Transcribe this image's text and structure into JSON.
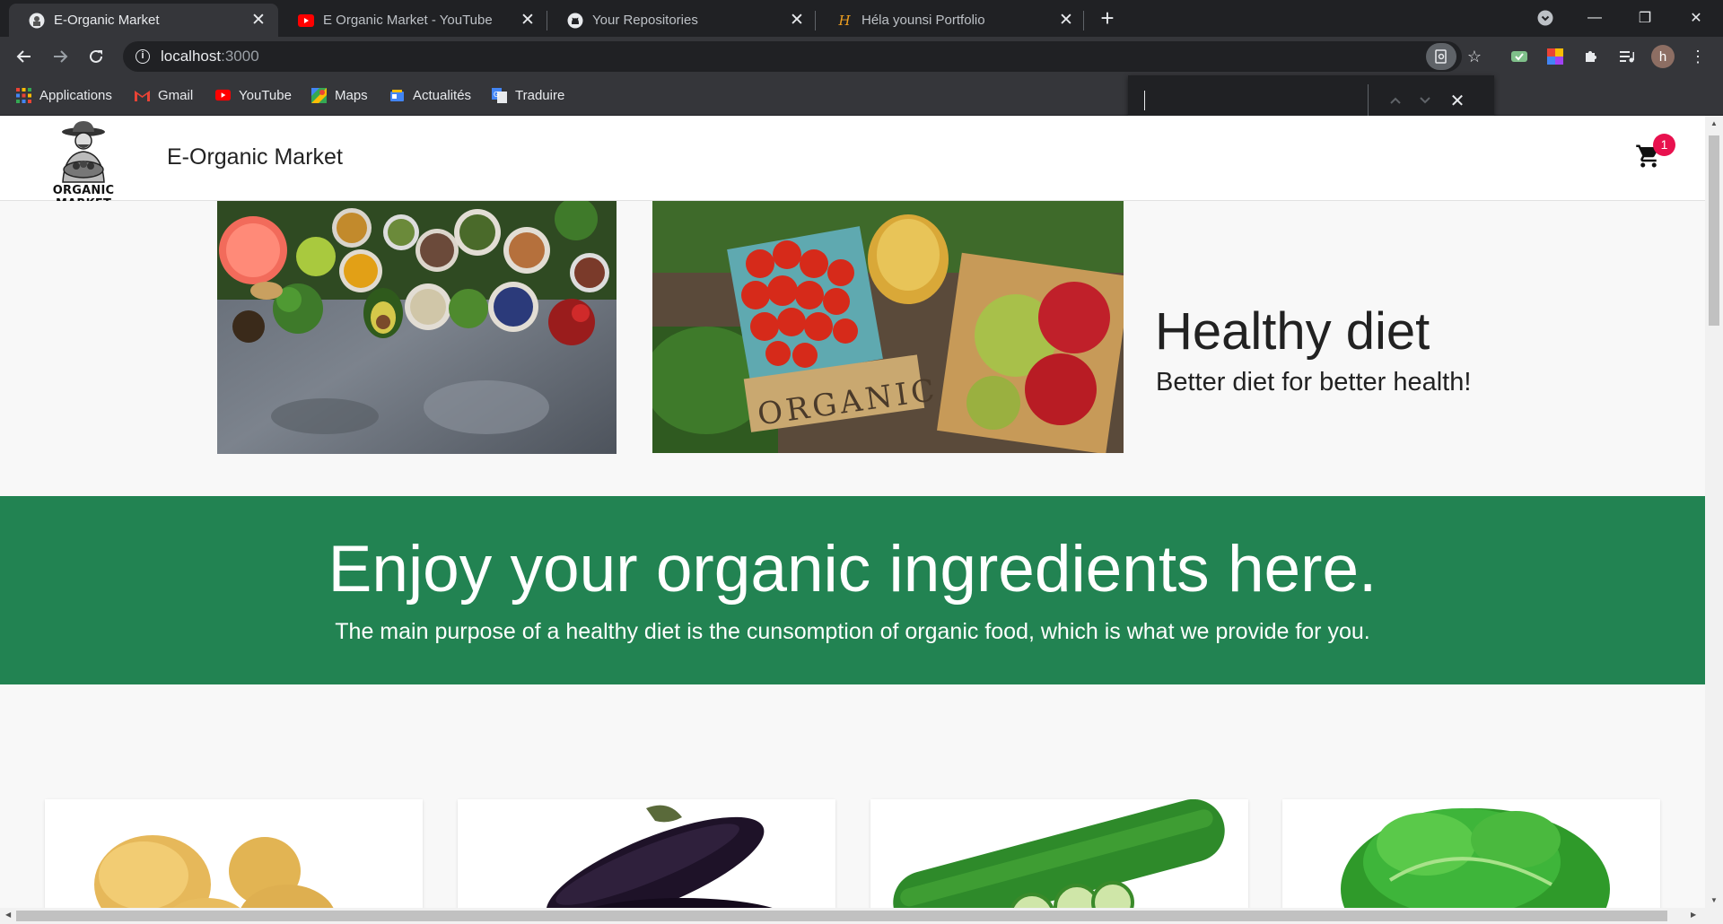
{
  "browser": {
    "tabs": [
      {
        "title": "E-Organic Market",
        "active": true,
        "favicon": "site-favicon"
      },
      {
        "title": "E Organic Market - YouTube",
        "active": false,
        "favicon": "youtube-icon"
      },
      {
        "title": "Your Repositories",
        "active": false,
        "favicon": "github-icon"
      },
      {
        "title": "Héla younsi Portfolio",
        "active": false,
        "favicon": "portfolio-icon"
      }
    ],
    "url_host": "localhost",
    "url_port": ":3000",
    "bookmarks": [
      {
        "label": "Applications",
        "icon": "apps-grid-icon"
      },
      {
        "label": "Gmail",
        "icon": "gmail-icon"
      },
      {
        "label": "YouTube",
        "icon": "youtube-icon"
      },
      {
        "label": "Maps",
        "icon": "maps-icon"
      },
      {
        "label": "Actualités",
        "icon": "news-icon"
      },
      {
        "label": "Traduire",
        "icon": "translate-icon"
      }
    ],
    "find_bar": {
      "query": ""
    },
    "profile_initial": "h"
  },
  "site": {
    "logo_text": "ORGANIC MARKET",
    "title": "E-Organic Market",
    "cart_count": "1",
    "colors": {
      "banner": "#228352",
      "badge": "#e8114e"
    }
  },
  "hero": {
    "title": "Healthy diet",
    "subtitle": "Better diet for better health!",
    "image2_label": "ORGANIC"
  },
  "banner": {
    "title": "Enjoy your organic ingredients here.",
    "subtitle": "The main purpose of a healthy diet is the cunsomption of organic food, which is what we provide for you."
  },
  "products": [
    {
      "name": "potatoes"
    },
    {
      "name": "eggplant"
    },
    {
      "name": "cucumber"
    },
    {
      "name": "lettuce"
    }
  ]
}
